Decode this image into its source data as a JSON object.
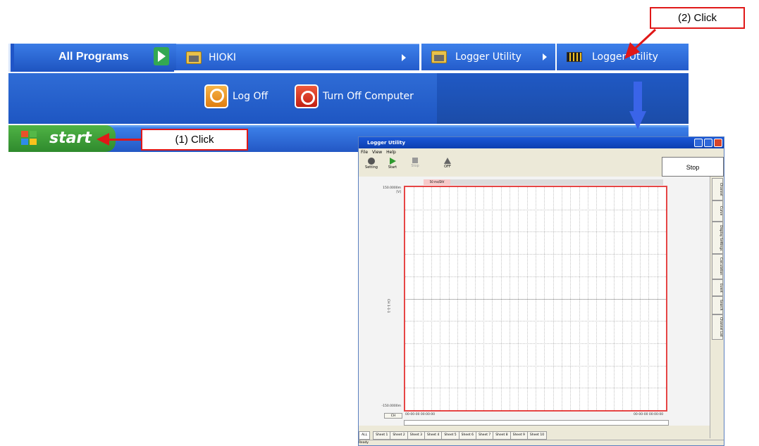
{
  "start_menu": {
    "all_programs": "All Programs",
    "submenu": [
      {
        "label": "HIOKI",
        "has_arrow": true
      },
      {
        "label": "Logger Utility",
        "has_arrow": true
      },
      {
        "label": "Logger Utility",
        "has_arrow": false
      }
    ],
    "log_off": "Log Off",
    "turn_off": "Turn Off Computer"
  },
  "taskbar": {
    "start_label": "start"
  },
  "annotations": {
    "step1": "(1) Click",
    "step2": "(2) Click"
  },
  "colors": {
    "xp_blue": "#245ccb",
    "start_green": "#2f8a2d",
    "callout_red": "#e01818",
    "grid_border": "#e64545"
  },
  "app": {
    "title": "Logger Utility",
    "menu": [
      "File",
      "View",
      "Help"
    ],
    "toolbar": [
      {
        "label": "Setting",
        "icon": "gear-icon"
      },
      {
        "label": "Start",
        "icon": "play-icon"
      },
      {
        "label": "Stop",
        "icon": "stop-icon"
      },
      {
        "label": "OFF",
        "icon": "cursor-icon"
      }
    ],
    "stop_button": "Stop",
    "time_div": "50 ms/DIV",
    "y_top": "150.0000m",
    "y_unit": "[V]",
    "y_bottom": "-150.0000m",
    "channel_label": "CH 1-1-1",
    "ch_button": "CH",
    "time_start": "00-00-00 00:00:00",
    "time_end": "00-00-00 00:00:00",
    "side_tabs": [
      "Channel",
      "Curve",
      "Display Settings",
      "Calculation",
      "Event",
      "Search",
      "Channel List"
    ],
    "sheets": [
      "ALL",
      "Sheet 1",
      "Sheet 2",
      "Sheet 3",
      "Sheet 4",
      "Sheet 5",
      "Sheet 6",
      "Sheet 7",
      "Sheet 8",
      "Sheet 9",
      "Sheet 10"
    ],
    "status": "Ready"
  }
}
